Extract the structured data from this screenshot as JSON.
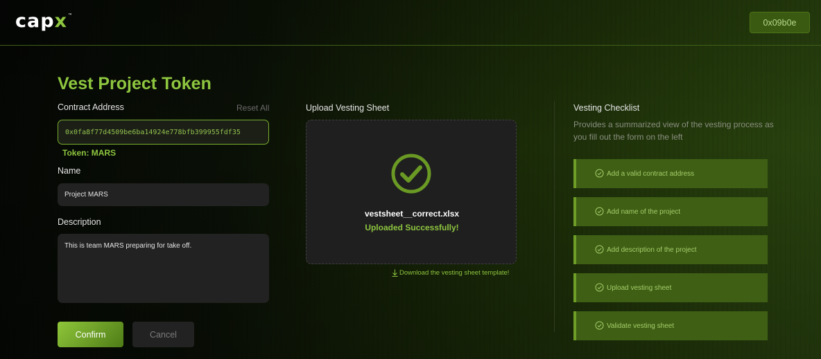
{
  "header": {
    "logo_main": "cap",
    "logo_accent": "x",
    "logo_tm": "™",
    "wallet_label": "0x09b0e"
  },
  "form": {
    "title": "Vest Project Token",
    "contract_label": "Contract Address",
    "reset_label": "Reset All",
    "contract_value": "0x0fa8f77d4509be6ba14924e778bfb399955fdf35",
    "token_label": "Token: MARS",
    "name_label": "Name",
    "name_value": "Project MARS",
    "description_label": "Description",
    "description_value": "This is team MARS preparing for take off.",
    "confirm_label": "Confirm",
    "cancel_label": "Cancel"
  },
  "upload": {
    "label": "Upload Vesting Sheet",
    "filename": "vestsheet__correct.xlsx",
    "status": "Uploaded Successfully!",
    "template_link": "Download the vesting sheet template!",
    "status_icon": "check-circle-icon"
  },
  "checklist": {
    "title": "Vesting Checklist",
    "subtitle": "Provides a summarized view of the vesting process as you fill out the form on the left",
    "items": [
      {
        "label": "Add a valid contract address",
        "icon": "check-circle-icon"
      },
      {
        "label": "Add name of the project",
        "icon": "check-circle-icon"
      },
      {
        "label": "Add description of the project",
        "icon": "check-circle-icon"
      },
      {
        "label": "Upload vesting sheet",
        "icon": "check-circle-icon"
      },
      {
        "label": "Validate vesting sheet",
        "icon": "check-circle-icon"
      }
    ]
  },
  "colors": {
    "accent": "#8ec63f",
    "checklist_bg": "#3e5f14",
    "panel_bg": "#222222"
  }
}
